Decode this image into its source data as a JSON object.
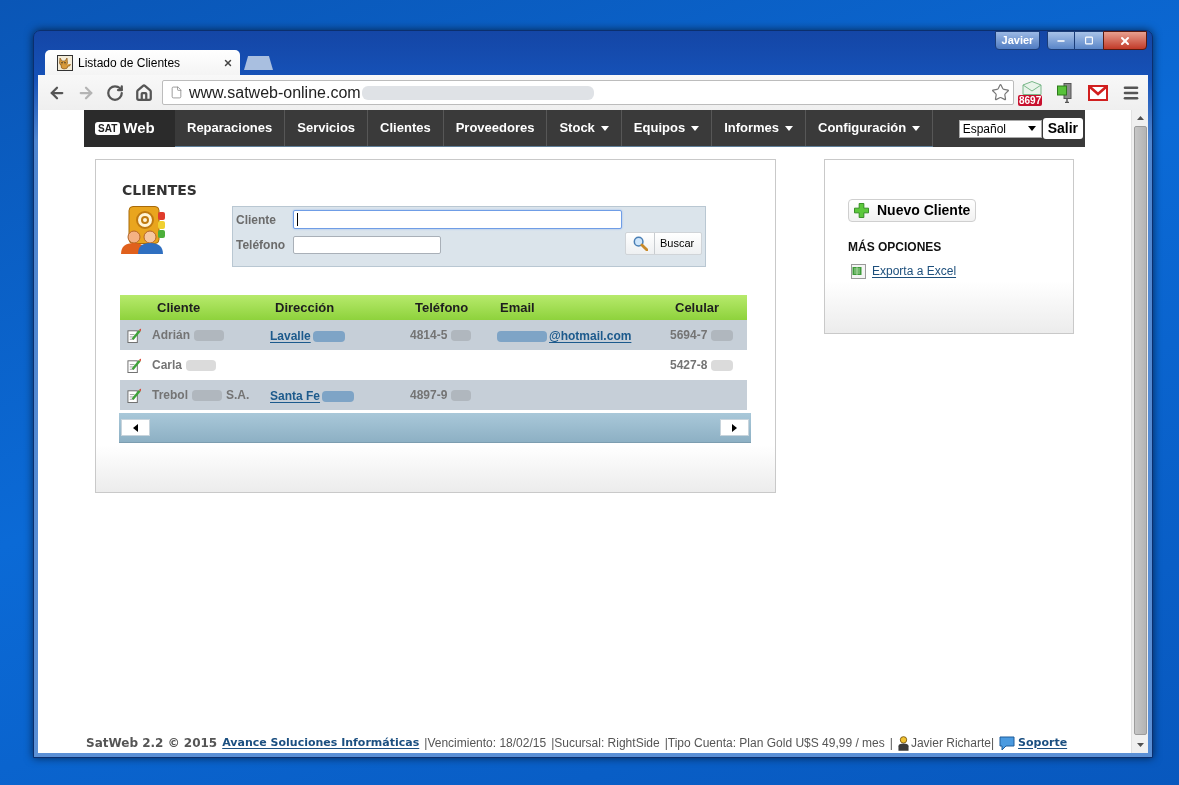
{
  "browser": {
    "profile_button": "Javier",
    "tabs": [
      {
        "title": "Listado de Clientes",
        "selected": true
      }
    ],
    "nav_buttons": [
      {
        "kind": "back",
        "disabled": false
      },
      {
        "kind": "forward",
        "disabled": true
      },
      {
        "kind": "reload",
        "disabled": false
      },
      {
        "kind": "home",
        "disabled": false
      }
    ],
    "address_bar": {
      "url": "www.satweb-online.com",
      "bookmarked": false
    },
    "extensions": [
      {
        "kind": "mail",
        "badge": "8697"
      },
      {
        "kind": "tool"
      },
      {
        "kind": "envelope"
      }
    ]
  },
  "navbar": {
    "logo": {
      "badge": "SAT",
      "text": "Web"
    },
    "items": [
      {
        "label": "Reparaciones",
        "has_menu": false
      },
      {
        "label": "Servicios",
        "has_menu": false
      },
      {
        "label": "Clientes",
        "has_menu": false
      },
      {
        "label": "Proveedores",
        "has_menu": false
      },
      {
        "label": "Stock",
        "has_menu": true
      },
      {
        "label": "Equipos",
        "has_menu": true
      },
      {
        "label": "Informes",
        "has_menu": true
      },
      {
        "label": "Configuración",
        "has_menu": true
      }
    ],
    "language": "Español",
    "logout": "Salir"
  },
  "clients_panel": {
    "title": "CLIENTES",
    "fields": [
      {
        "label": "Cliente",
        "focused": true
      },
      {
        "label": "Teléfono",
        "focused": false
      }
    ],
    "search_button": "Buscar",
    "table": {
      "columns": [
        "Cliente",
        "Dirección",
        "Teléfono",
        "Email",
        "Celular"
      ],
      "rows": [
        {
          "cells": [
            {
              "link": false,
              "parts": [
                {
                  "kind": "text",
                  "text": "Adrián"
                },
                {
                  "kind": "redacted"
                }
              ]
            },
            {
              "link": true,
              "parts": [
                {
                  "kind": "text",
                  "text": "Lavalle"
                },
                {
                  "kind": "redacted"
                }
              ]
            },
            {
              "link": false,
              "parts": [
                {
                  "kind": "text",
                  "text": "4814-5"
                },
                {
                  "kind": "redacted"
                }
              ]
            },
            {
              "link": true,
              "parts": [
                {
                  "kind": "redacted"
                },
                {
                  "kind": "text",
                  "text": "@hotmail.com"
                }
              ]
            },
            {
              "link": false,
              "parts": [
                {
                  "kind": "text",
                  "text": "5694-7"
                },
                {
                  "kind": "redacted"
                }
              ]
            }
          ]
        },
        {
          "cells": [
            {
              "link": false,
              "parts": [
                {
                  "kind": "text",
                  "text": "Carla"
                },
                {
                  "kind": "redacted"
                }
              ]
            },
            null,
            null,
            null,
            {
              "link": false,
              "parts": [
                {
                  "kind": "text",
                  "text": "5427-8"
                },
                {
                  "kind": "redacted"
                }
              ]
            }
          ]
        },
        {
          "cells": [
            {
              "link": false,
              "parts": [
                {
                  "kind": "text",
                  "text": "Trebol"
                },
                {
                  "kind": "redacted"
                },
                {
                  "kind": "text",
                  "text": "S.A."
                }
              ]
            },
            {
              "link": true,
              "parts": [
                {
                  "kind": "text",
                  "text": "Santa Fe"
                },
                {
                  "kind": "redacted"
                }
              ]
            },
            {
              "link": false,
              "parts": [
                {
                  "kind": "text",
                  "text": "4897-9"
                },
                {
                  "kind": "redacted"
                }
              ]
            },
            null,
            null
          ]
        }
      ]
    }
  },
  "options_panel": {
    "new_button": "Nuevo Cliente",
    "heading": "MÁS OPCIONES",
    "links": [
      "Exporta a Excel"
    ]
  },
  "footer": [
    {
      "kind": "brand",
      "text": "SatWeb 2.2 © 2015"
    },
    {
      "kind": "link",
      "text": "Avance Soluciones Informáticas"
    },
    {
      "kind": "text",
      "text": "|Vencimiento: 18/02/15"
    },
    {
      "kind": "text",
      "text": "|Sucursal: RightSide"
    },
    {
      "kind": "text",
      "text": "|Tipo Cuenta: Plan Gold U$S 49,99 / mes"
    },
    {
      "kind": "text",
      "text": "|"
    },
    {
      "kind": "user",
      "text": "Javier Richarte|"
    },
    {
      "kind": "support",
      "text": "Soporte"
    }
  ]
}
